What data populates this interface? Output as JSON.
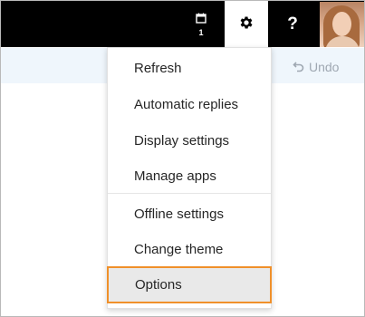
{
  "topbar": {
    "calendar_badge": "1",
    "help_label": "?"
  },
  "toolbar": {
    "undo_label": "Undo"
  },
  "settings_menu": {
    "items": [
      {
        "label": "Refresh"
      },
      {
        "label": "Automatic replies"
      },
      {
        "label": "Display settings"
      },
      {
        "label": "Manage apps"
      },
      {
        "label": "Offline settings"
      },
      {
        "label": "Change theme"
      },
      {
        "label": "Options"
      }
    ],
    "highlighted_item": "Options",
    "highlight_color": "#f0902a"
  },
  "colors": {
    "topbar_background": "#000000",
    "toolbar_background": "#eff6fc"
  },
  "icons": [
    "calendar-icon",
    "gear-icon",
    "help-icon",
    "undo-icon",
    "avatar"
  ]
}
